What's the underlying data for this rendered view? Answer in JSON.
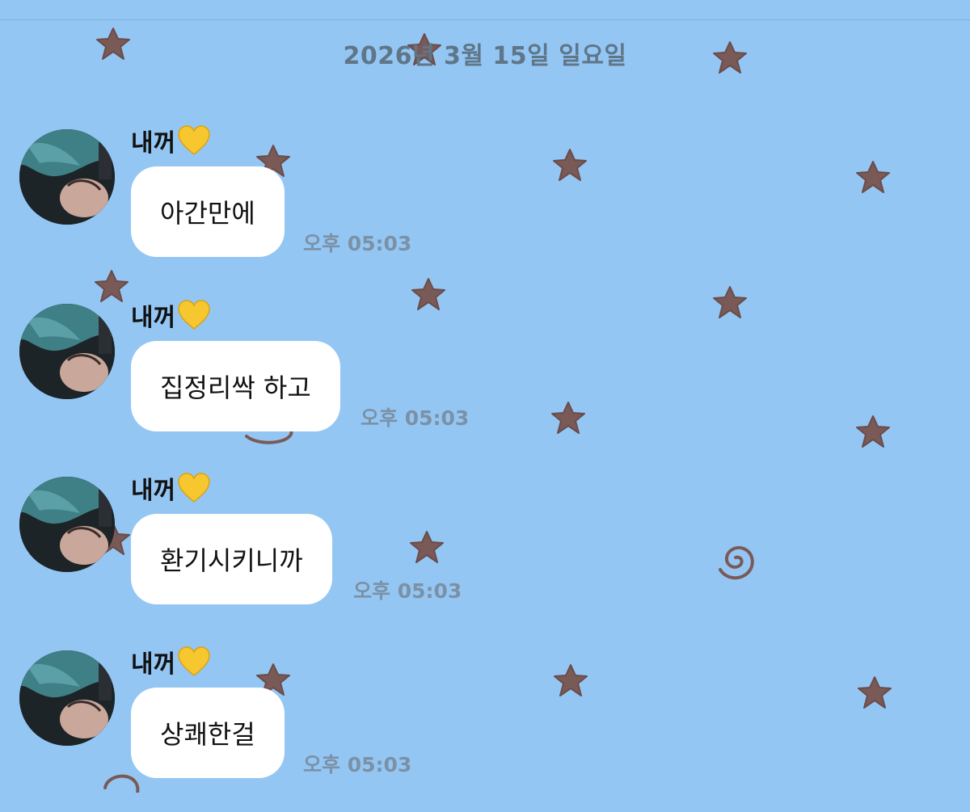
{
  "chat": {
    "date_divider": "2026년 3월 15일 일요일",
    "messages": [
      {
        "sender": "내꺼",
        "text": "아간만에",
        "time": "오후 05:03"
      },
      {
        "sender": "내꺼",
        "text": "집정리싹 하고",
        "time": "오후 05:03"
      },
      {
        "sender": "내꺼",
        "text": "환기시키니까",
        "time": "오후 05:03"
      },
      {
        "sender": "내꺼",
        "text": "상쾌한걸",
        "time": "오후 05:03"
      }
    ]
  },
  "colors": {
    "background": "#94c6f4",
    "bubble": "#ffffff",
    "doodle": "#7a5a57",
    "timestamp": "#7b91a6"
  },
  "icons": {
    "heart": "yellow-heart-icon",
    "star": "star-icon",
    "spiral": "spiral-icon"
  }
}
